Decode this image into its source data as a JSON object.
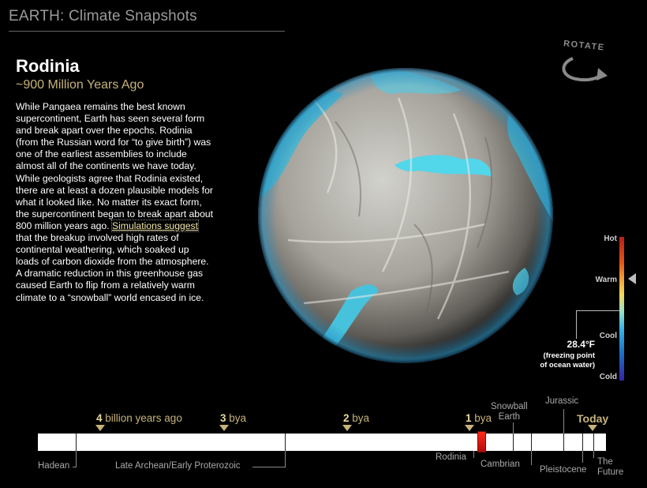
{
  "app": {
    "title": "EARTH: Climate Snapshots"
  },
  "era": {
    "name": "Rodinia",
    "age": "~900 Million Years Ago",
    "description_before": "While Pangaea remains the best known supercontinent, Earth has seen several form and break apart over the epochs. Rodinia (from the Russian word for “to give birth”) was one of the earliest assemblies to include almost all of the continents we have today. While geologists agree that Rodinia existed, there are at least a dozen plausible models for what it looked like. No matter its exact form, the supercontinent began to break apart about 800 million years ago. ",
    "description_link": "Simulations suggest",
    "description_after": " that the breakup involved high rates of continental weathering, which soaked up loads of carbon dioxide from the atmosphere. A dramatic reduction in this greenhouse gas caused Earth to flip from a relatively warm climate to a “snowball” world encased in ice."
  },
  "rotate": {
    "label": "ROTATE",
    "icon": "rotate-arrow-icon"
  },
  "temperature_scale": {
    "hot": "Hot",
    "warm": "Warm",
    "cool": "Cool",
    "cold": "Cold",
    "reference_value": "28.4°F",
    "reference_note_line1": "(freezing point",
    "reference_note_line2": "of ocean water)",
    "pointer_level": "Warm"
  },
  "timeline": {
    "ticks": [
      {
        "num": "4",
        "text": " billion years ago"
      },
      {
        "num": "3",
        "text": " bya"
      },
      {
        "num": "2",
        "text": " bya"
      },
      {
        "num": "1",
        "text": " bya"
      }
    ],
    "today": "Today",
    "eras": {
      "hadean": "Hadean",
      "late_archean": "Late Archean/Early Proterozoic",
      "rodinia": "Rodinia",
      "snowball_line1": "Snowball",
      "snowball_line2": "Earth",
      "cambrian": "Cambrian",
      "jurassic": "Jurassic",
      "pleistocene": "Pleistocene",
      "future_line1": "The",
      "future_line2": "Future"
    },
    "selected": "Rodinia"
  },
  "colors": {
    "background": "#000000",
    "accent_gold": "#c7b37a",
    "ocean": "#4fd0e6",
    "marker": "#e01a12"
  }
}
